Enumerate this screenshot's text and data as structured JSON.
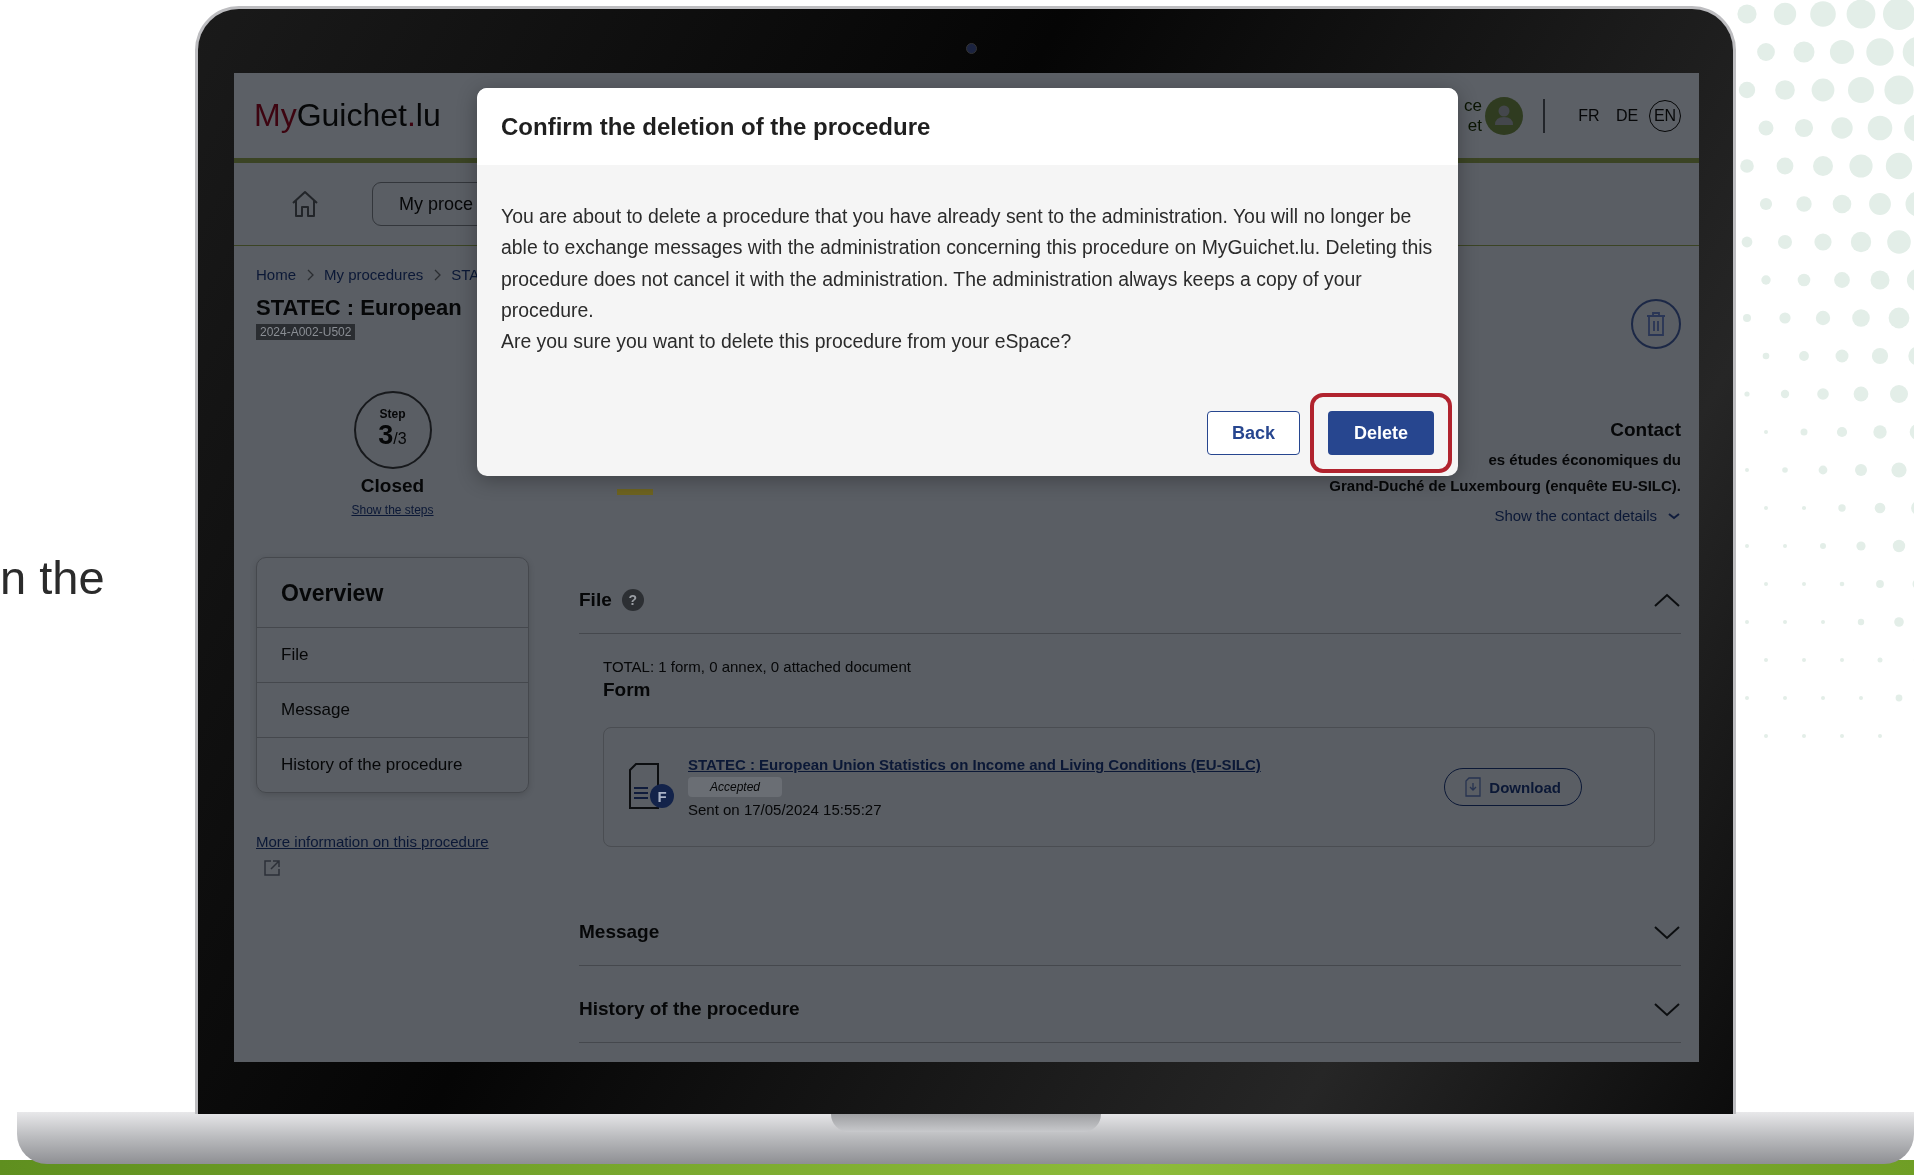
{
  "caption": "n the",
  "header": {
    "logo": [
      {
        "text": "My",
        "accent": true
      },
      {
        "text": "Guichet",
        "accent": false
      },
      {
        "text": ".",
        "accent": true
      },
      {
        "text": "lu",
        "accent": false
      }
    ],
    "account_fragments": [
      "ce",
      "et"
    ],
    "languages": [
      {
        "label": "FR",
        "selected": false
      },
      {
        "label": "DE",
        "selected": false
      },
      {
        "label": "EN",
        "selected": true
      }
    ]
  },
  "nav": {
    "button": "My proce"
  },
  "breadcrumb": [
    "Home",
    "My procedures",
    "STA"
  ],
  "procedure": {
    "title": "STATEC : European",
    "reference": "2024-A002-U502"
  },
  "step": {
    "label": "Step",
    "current": "3",
    "total": "/3",
    "status": "Closed",
    "link": "Show the steps"
  },
  "contact": {
    "title": "Contact",
    "lines": [
      "es études économiques du",
      "Grand-Duché de Luxembourg (enquête EU-SILC)."
    ],
    "link": "Show the contact details"
  },
  "sidebar": {
    "title": "Overview",
    "items": [
      "File",
      "Message",
      "History of the procedure"
    ],
    "link": "More information on this procedure"
  },
  "sections": [
    {
      "title": "File",
      "help_icon": "?",
      "expanded": true,
      "content": {
        "total": "TOTAL: 1 form, 0 annex, 0 attached document",
        "heading": "Form",
        "document": {
          "icon_letter": "F",
          "title": "STATEC : European Union Statistics on Income and Living Conditions (EU-SILC)",
          "status": "Accepted",
          "sent": "Sent on 17/05/2024 15:55:27",
          "download": "Download"
        }
      }
    },
    {
      "title": "Message",
      "expanded": false
    },
    {
      "title": "History of the procedure",
      "expanded": false
    }
  ],
  "dialog": {
    "title": "Confirm the deletion of the procedure",
    "paragraphs": [
      "You are about to delete a procedure that you have already sent to the administration. You will no longer be able to exchange messages with the administration concerning this procedure on MyGuichet.lu. Deleting this procedure does not cancel it with the administration. The administration always keeps a copy of your procedure.",
      "Are you sure you want to delete this procedure from your eSpace?"
    ],
    "buttons": [
      {
        "label": "Back",
        "kind": "secondary",
        "highlighted": false
      },
      {
        "label": "Delete",
        "kind": "primary",
        "highlighted": true
      }
    ]
  }
}
